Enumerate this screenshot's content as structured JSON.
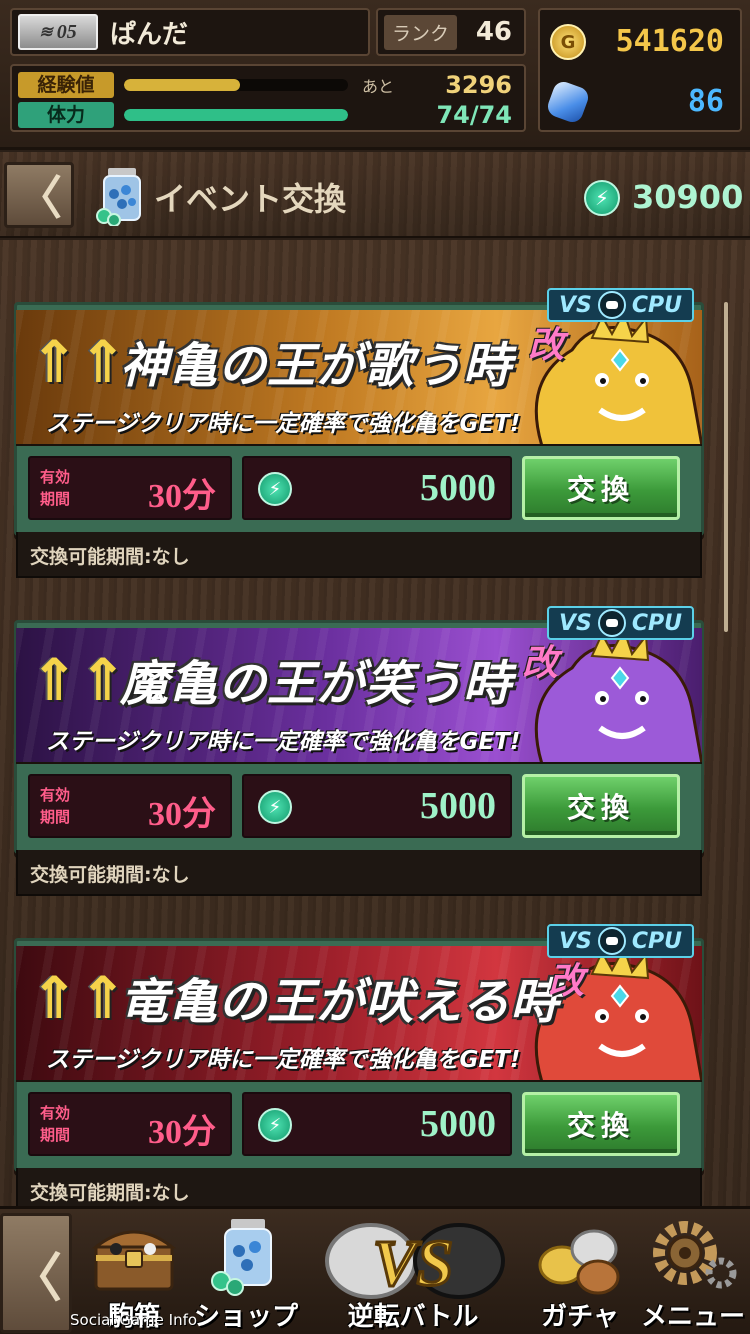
{
  "status": {
    "level_badge": "05",
    "player_name": "ぱんだ",
    "rank_label": "ランク",
    "rank_value": "46",
    "gold": "541620",
    "gems": "86",
    "exp_label": "経験値",
    "exp_aside": "あと",
    "exp_value": "3296",
    "exp_fill_fraction": 0.52,
    "stamina_label": "体力",
    "stamina_value": "74/74",
    "stamina_fill_fraction": 1.0
  },
  "header": {
    "back_label": "〈",
    "title": "イベント交換",
    "points": "30900"
  },
  "cards": [
    {
      "badge_vs": "VS",
      "badge_cpu": "CPU",
      "title": "神亀の王が歌う時",
      "title_suffix": "改",
      "subtitle": "ステージクリア時に一定確率で強化亀をGET!",
      "theme": "gold",
      "duration_label_1": "有効",
      "duration_label_2": "期間",
      "duration_value": "30分",
      "cost": "5000",
      "button_label": "交換",
      "period_text": "交換可能期間:なし"
    },
    {
      "badge_vs": "VS",
      "badge_cpu": "CPU",
      "title": "魔亀の王が笑う時",
      "title_suffix": "改",
      "subtitle": "ステージクリア時に一定確率で強化亀をGET!",
      "theme": "purple",
      "duration_label_1": "有効",
      "duration_label_2": "期間",
      "duration_value": "30分",
      "cost": "5000",
      "button_label": "交換",
      "period_text": "交換可能期間:なし"
    },
    {
      "badge_vs": "VS",
      "badge_cpu": "CPU",
      "title": "竜亀の王が吠える時",
      "title_suffix": "改",
      "subtitle": "ステージクリア時に一定確率で強化亀をGET!",
      "theme": "red",
      "duration_label_1": "有効",
      "duration_label_2": "期間",
      "duration_value": "30分",
      "cost": "5000",
      "button_label": "交換",
      "period_text": "交換可能期間:なし"
    }
  ],
  "nav": {
    "back_label": "〈",
    "items": [
      {
        "label": "駒箱",
        "icon": "chest-icon"
      },
      {
        "label": "ショップ",
        "icon": "jar-icon"
      },
      {
        "label": "逆転バトル",
        "icon": "vs-icon"
      },
      {
        "label": "ガチャ",
        "icon": "coins-icon"
      },
      {
        "label": "メニュー",
        "icon": "gear-icon"
      }
    ]
  },
  "watermark": "Social Game Info",
  "colors": {
    "gold_text": "#f4c64a",
    "gem_text": "#4cb8ff",
    "exp_bar": "#d7b23a",
    "stamina_bar": "#2fbf88",
    "theme_gold": "#b9731c",
    "theme_purple": "#6a2f9e",
    "theme_red": "#9c1f2a"
  }
}
